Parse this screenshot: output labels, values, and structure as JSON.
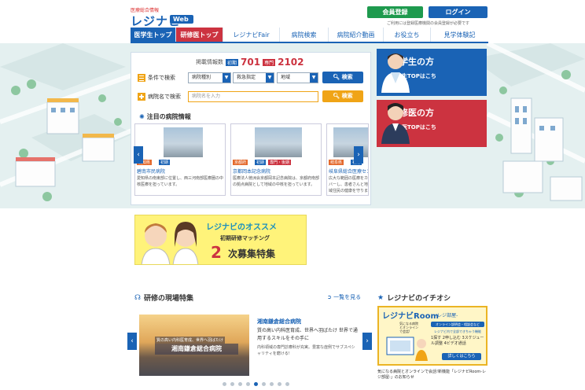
{
  "header": {
    "logo_small": "医療総合情報",
    "logo_main": "レジナビ",
    "logo_web": "Web",
    "member_button": "会員登録",
    "login_button": "ログイン",
    "note": "ご利用には登録医療機関の会員登録が必要です"
  },
  "nav": [
    {
      "label": "医学生トップ"
    },
    {
      "label": "研修医トップ"
    },
    {
      "label": "レジナビFair"
    },
    {
      "label": "病院検索"
    },
    {
      "label": "病院紹介動画"
    },
    {
      "label": "お役立ち"
    },
    {
      "label": "見学体験記"
    }
  ],
  "search": {
    "count_label": "掲載情報数",
    "badge_initial": "初期",
    "count_initial": "701",
    "badge_specialty": "専門",
    "count_specialty": "2102",
    "condition_label": "条件で検索",
    "select_type": "病院種別",
    "select_emergency": "救急指定",
    "select_region": "地域",
    "search_button": "検索",
    "name_label": "病院名で検索",
    "name_placeholder": "病院名を入力",
    "name_button": "検索"
  },
  "featured": {
    "title": "注目の病院情報",
    "cards": [
      {
        "pref": "愛知県",
        "tag1": "初期",
        "tag2": "",
        "name": "碧南市民病院",
        "desc": "愛知県の南東部に位置し、西三河南部医療圏の中核医療を担っています。"
      },
      {
        "pref": "京都府",
        "tag1": "初期",
        "tag2": "専門・後期",
        "name": "京都岡本記念病院",
        "desc": "医療法人徳洲会京都岡本記念病院は、京都府南部の拠点病院として地域の中核を担っています。"
      },
      {
        "pref": "岐阜県",
        "tag1": "初期",
        "tag2": "",
        "name": "岐阜県総合医療センター",
        "desc": "広大な範囲の医療をカバーし、患者さんと地域住民の健康を守ります。"
      }
    ]
  },
  "side_cards": {
    "student_title": "医学生の方",
    "student_sub": "医学生TOPはこちら",
    "resident_title": "研修医の方",
    "resident_sub": "研修医TOPはこちら"
  },
  "banner": {
    "line1": "レジナビのオススメ",
    "line2": "初期研修マッチング",
    "line3_num": "2",
    "line3_text": "次募集特集"
  },
  "field_section": {
    "title": "研修の現場特集",
    "more_link": "一覧を見る",
    "feature_caption": "質の高い内科医育成、世界へ羽ばたけ",
    "feature_image_title": "湘南鎌倉総合病院",
    "feature_title": "湘南鎌倉総合病院",
    "feature_desc": "質の高い内科医育成、世界へ羽ばたけ 世界で通用するスキルをその手に",
    "feature_desc2": "内科領域の専門診療科が充実。豊富な症例でサブスペシャリティを磨ける!"
  },
  "pick_section": {
    "title": "レジナビのイチオシ",
    "room_title": "レジナビRoom",
    "room_subtitle": "-レジ部屋-",
    "room_prompt": "気になる病院とオンラインで会話!",
    "room_btn1": "オンライン説明会・相談会など",
    "room_btn2": "レジナビ内で全部できちゃう機能",
    "room_steps": "1探す 2申し込む 3スケジュール調整 4ビデオ通話",
    "room_detail": "詳しくはこちら",
    "room_note": "気になる病院とオンラインで会話!新機能「レジナビRoom-レジ部屋-」のお知らせ"
  },
  "pager": {
    "count": 9,
    "active": 4
  },
  "colors": {
    "brand_blue": "#1a63b5",
    "brand_red": "#cc3340",
    "green": "#1e9a4e",
    "orange": "#f0a416"
  }
}
